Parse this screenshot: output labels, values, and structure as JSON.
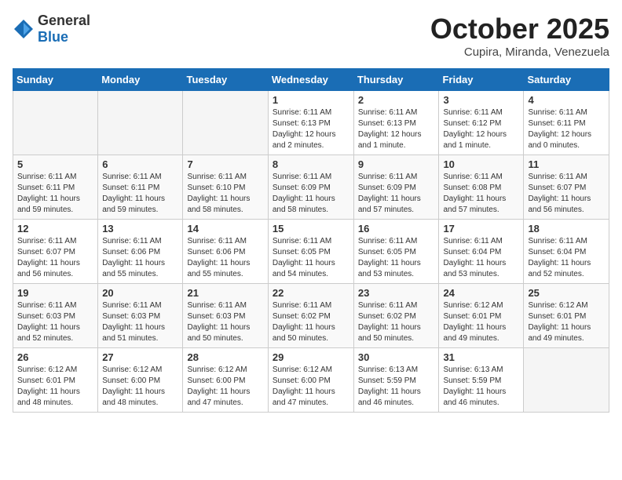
{
  "header": {
    "logo_general": "General",
    "logo_blue": "Blue",
    "month_title": "October 2025",
    "location": "Cupira, Miranda, Venezuela"
  },
  "weekdays": [
    "Sunday",
    "Monday",
    "Tuesday",
    "Wednesday",
    "Thursday",
    "Friday",
    "Saturday"
  ],
  "weeks": [
    [
      {
        "day": "",
        "info": ""
      },
      {
        "day": "",
        "info": ""
      },
      {
        "day": "",
        "info": ""
      },
      {
        "day": "1",
        "info": "Sunrise: 6:11 AM\nSunset: 6:13 PM\nDaylight: 12 hours\nand 2 minutes."
      },
      {
        "day": "2",
        "info": "Sunrise: 6:11 AM\nSunset: 6:13 PM\nDaylight: 12 hours\nand 1 minute."
      },
      {
        "day": "3",
        "info": "Sunrise: 6:11 AM\nSunset: 6:12 PM\nDaylight: 12 hours\nand 1 minute."
      },
      {
        "day": "4",
        "info": "Sunrise: 6:11 AM\nSunset: 6:11 PM\nDaylight: 12 hours\nand 0 minutes."
      }
    ],
    [
      {
        "day": "5",
        "info": "Sunrise: 6:11 AM\nSunset: 6:11 PM\nDaylight: 11 hours\nand 59 minutes."
      },
      {
        "day": "6",
        "info": "Sunrise: 6:11 AM\nSunset: 6:11 PM\nDaylight: 11 hours\nand 59 minutes."
      },
      {
        "day": "7",
        "info": "Sunrise: 6:11 AM\nSunset: 6:10 PM\nDaylight: 11 hours\nand 58 minutes."
      },
      {
        "day": "8",
        "info": "Sunrise: 6:11 AM\nSunset: 6:09 PM\nDaylight: 11 hours\nand 58 minutes."
      },
      {
        "day": "9",
        "info": "Sunrise: 6:11 AM\nSunset: 6:09 PM\nDaylight: 11 hours\nand 57 minutes."
      },
      {
        "day": "10",
        "info": "Sunrise: 6:11 AM\nSunset: 6:08 PM\nDaylight: 11 hours\nand 57 minutes."
      },
      {
        "day": "11",
        "info": "Sunrise: 6:11 AM\nSunset: 6:07 PM\nDaylight: 11 hours\nand 56 minutes."
      }
    ],
    [
      {
        "day": "12",
        "info": "Sunrise: 6:11 AM\nSunset: 6:07 PM\nDaylight: 11 hours\nand 56 minutes."
      },
      {
        "day": "13",
        "info": "Sunrise: 6:11 AM\nSunset: 6:06 PM\nDaylight: 11 hours\nand 55 minutes."
      },
      {
        "day": "14",
        "info": "Sunrise: 6:11 AM\nSunset: 6:06 PM\nDaylight: 11 hours\nand 55 minutes."
      },
      {
        "day": "15",
        "info": "Sunrise: 6:11 AM\nSunset: 6:05 PM\nDaylight: 11 hours\nand 54 minutes."
      },
      {
        "day": "16",
        "info": "Sunrise: 6:11 AM\nSunset: 6:05 PM\nDaylight: 11 hours\nand 53 minutes."
      },
      {
        "day": "17",
        "info": "Sunrise: 6:11 AM\nSunset: 6:04 PM\nDaylight: 11 hours\nand 53 minutes."
      },
      {
        "day": "18",
        "info": "Sunrise: 6:11 AM\nSunset: 6:04 PM\nDaylight: 11 hours\nand 52 minutes."
      }
    ],
    [
      {
        "day": "19",
        "info": "Sunrise: 6:11 AM\nSunset: 6:03 PM\nDaylight: 11 hours\nand 52 minutes."
      },
      {
        "day": "20",
        "info": "Sunrise: 6:11 AM\nSunset: 6:03 PM\nDaylight: 11 hours\nand 51 minutes."
      },
      {
        "day": "21",
        "info": "Sunrise: 6:11 AM\nSunset: 6:03 PM\nDaylight: 11 hours\nand 50 minutes."
      },
      {
        "day": "22",
        "info": "Sunrise: 6:11 AM\nSunset: 6:02 PM\nDaylight: 11 hours\nand 50 minutes."
      },
      {
        "day": "23",
        "info": "Sunrise: 6:11 AM\nSunset: 6:02 PM\nDaylight: 11 hours\nand 50 minutes."
      },
      {
        "day": "24",
        "info": "Sunrise: 6:12 AM\nSunset: 6:01 PM\nDaylight: 11 hours\nand 49 minutes."
      },
      {
        "day": "25",
        "info": "Sunrise: 6:12 AM\nSunset: 6:01 PM\nDaylight: 11 hours\nand 49 minutes."
      }
    ],
    [
      {
        "day": "26",
        "info": "Sunrise: 6:12 AM\nSunset: 6:01 PM\nDaylight: 11 hours\nand 48 minutes."
      },
      {
        "day": "27",
        "info": "Sunrise: 6:12 AM\nSunset: 6:00 PM\nDaylight: 11 hours\nand 48 minutes."
      },
      {
        "day": "28",
        "info": "Sunrise: 6:12 AM\nSunset: 6:00 PM\nDaylight: 11 hours\nand 47 minutes."
      },
      {
        "day": "29",
        "info": "Sunrise: 6:12 AM\nSunset: 6:00 PM\nDaylight: 11 hours\nand 47 minutes."
      },
      {
        "day": "30",
        "info": "Sunrise: 6:13 AM\nSunset: 5:59 PM\nDaylight: 11 hours\nand 46 minutes."
      },
      {
        "day": "31",
        "info": "Sunrise: 6:13 AM\nSunset: 5:59 PM\nDaylight: 11 hours\nand 46 minutes."
      },
      {
        "day": "",
        "info": ""
      }
    ]
  ]
}
